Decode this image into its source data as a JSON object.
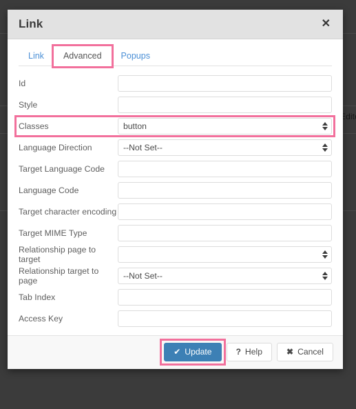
{
  "background": {
    "watermark_text": "Edito"
  },
  "dialog": {
    "title": "Link",
    "close_icon": "✕",
    "tabs": [
      {
        "label": "Link",
        "active": false,
        "highlighted": false
      },
      {
        "label": "Advanced",
        "active": true,
        "highlighted": true
      },
      {
        "label": "Popups",
        "active": false,
        "highlighted": false
      }
    ],
    "fields": [
      {
        "label": "Id",
        "type": "text",
        "value": "",
        "placeholder": "",
        "highlighted": false
      },
      {
        "label": "Style",
        "type": "text",
        "value": "",
        "placeholder": "",
        "highlighted": false
      },
      {
        "label": "Classes",
        "type": "select",
        "value": "button",
        "highlighted": true
      },
      {
        "label": "Language Direction",
        "type": "select",
        "value": "--Not Set--",
        "highlighted": false
      },
      {
        "label": "Target Language Code",
        "type": "text",
        "value": "",
        "placeholder": "",
        "highlighted": false
      },
      {
        "label": "Language Code",
        "type": "text",
        "value": "",
        "placeholder": "",
        "highlighted": false
      },
      {
        "label": "Target character encoding",
        "type": "text",
        "value": "",
        "placeholder": "",
        "highlighted": false
      },
      {
        "label": "Target MIME Type",
        "type": "text",
        "value": "",
        "placeholder": "",
        "highlighted": false
      },
      {
        "label": "Relationship page to target",
        "type": "select",
        "value": "",
        "highlighted": false
      },
      {
        "label": "Relationship target to page",
        "type": "select",
        "value": "--Not Set--",
        "highlighted": false
      },
      {
        "label": "Tab Index",
        "type": "text",
        "value": "",
        "placeholder": "",
        "highlighted": false
      },
      {
        "label": "Access Key",
        "type": "text",
        "value": "",
        "placeholder": "",
        "highlighted": false
      }
    ],
    "footer": {
      "update_label": "Update",
      "update_icon": "✔",
      "help_label": "Help",
      "help_icon": "?",
      "cancel_label": "Cancel",
      "cancel_icon": "✖"
    }
  },
  "colors": {
    "accent_blue": "#3d80b5",
    "highlight_pink": "#f2709c",
    "link_blue": "#4a8fd6",
    "header_gray": "#e2e2e2",
    "backdrop": "#3b3b3b"
  }
}
